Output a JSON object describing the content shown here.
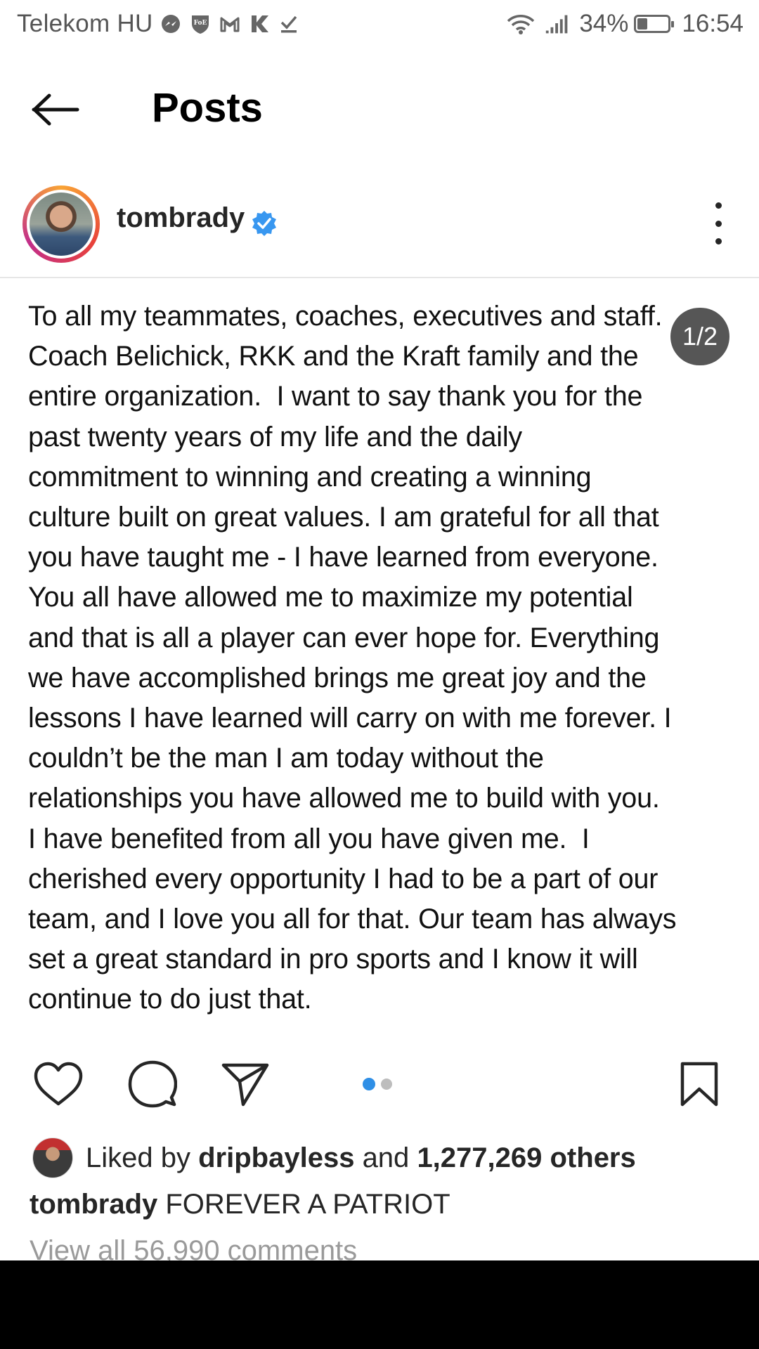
{
  "status_bar": {
    "carrier": "Telekom HU",
    "battery_percent": "34%",
    "battery_level": 0.34,
    "time": "16:54",
    "left_icons": [
      "messenger-icon",
      "foe-shield-icon",
      "gmail-icon",
      "k-app-icon",
      "download-check-icon"
    ],
    "right_icons": [
      "wifi-icon",
      "signal-icon",
      "battery-icon"
    ]
  },
  "header": {
    "title": "Posts"
  },
  "post": {
    "username": "tombrady",
    "verified": true,
    "page_indicator": "1/2",
    "carousel_pages": 2,
    "carousel_active": 1,
    "body": "To all my teammates, coaches, executives and staff.\nCoach Belichick, RKK and the Kraft family and the\nentire organization.  I want to say thank you for the\npast twenty years of my life and the daily\ncommitment to winning and creating a winning\nculture built on great values. I am grateful for all that\nyou have taught me - I have learned from everyone.\nYou all have allowed me to maximize my potential\nand that is all a player can ever hope for. Everything\nwe have accomplished brings me great joy and the\nlessons I have learned will carry on with me forever. I\ncouldn’t be the man I am today without the\nrelationships you have allowed me to build with you.\nI have benefited from all you have given me.  I\ncherished every opportunity I had to be a part of our\nteam, and I love you all for that. Our team has always\nset a great standard in pro sports and I know it will\ncontinue to do just that."
  },
  "likes": {
    "prefix": "Liked by",
    "liker": "dripbayless",
    "joiner": "and",
    "others": "1,277,269 others"
  },
  "caption": {
    "username": "tombrady",
    "text": "FOREVER A PATRIOT"
  },
  "comments": {
    "view_all": "View all 56,990 comments"
  },
  "colors": {
    "accent_blue": "#2f8fe6",
    "verified_blue": "#3897f0",
    "text": "#262626",
    "muted": "#9a9a9a"
  }
}
